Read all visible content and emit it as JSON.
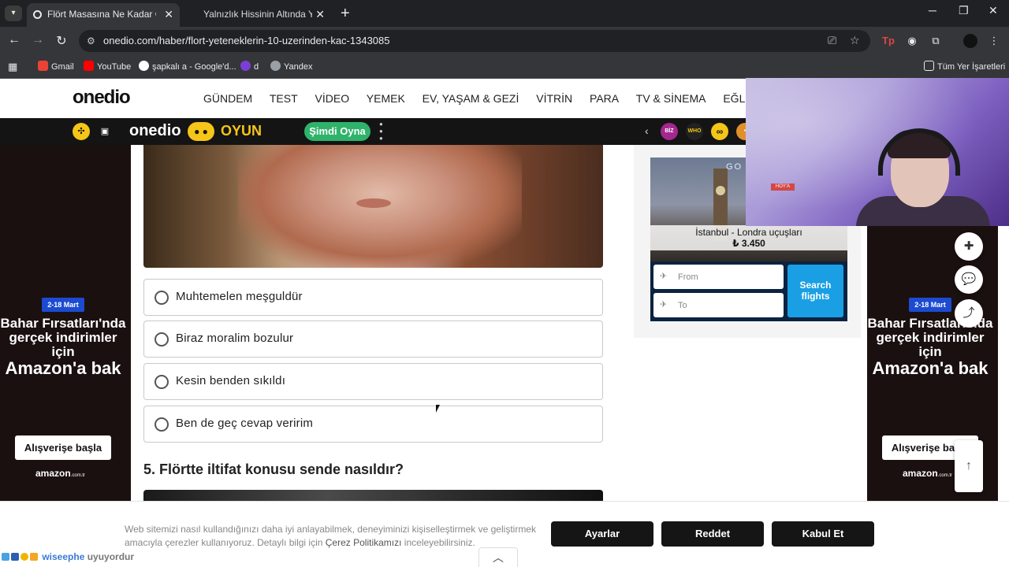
{
  "browser": {
    "tabs": [
      {
        "title": "Flört Masasına Ne Kadar Güçlü",
        "active": true
      },
      {
        "title": "Yalnızlık Hissinin Altında Yatan (",
        "active": false
      }
    ],
    "new_tab": "+",
    "url": "onedio.com/haber/flort-yeteneklerin-10-uzerinden-kac-1343085",
    "bookmarks": [
      "Gmail",
      "YouTube",
      "şapkalı a - Google'd...",
      "d",
      "Yandex"
    ],
    "all_bookmarks": "Tüm Yer İşaretleri",
    "icons": {
      "back": "←",
      "forward": "→",
      "reload": "↻",
      "star": "☆",
      "menu": "⋮",
      "minimize": "─",
      "maximize": "❐",
      "close": "✕"
    }
  },
  "site": {
    "logo": "onedio",
    "nav": [
      "GÜNDEM",
      "TEST",
      "VİDEO",
      "YEMEK",
      "EV, YAŞAM & GEZİ",
      "VİTRİN",
      "PARA",
      "TV & SİNEMA",
      "EĞLENCE"
    ]
  },
  "gamebar": {
    "logo": "onedio",
    "oyun": "OYUN",
    "play": "Şimdi Oyna",
    "games": [
      "BİZ POS",
      "WHO WAS",
      "∞",
      "•"
    ]
  },
  "quiz": {
    "options": [
      "Muhtemelen meşguldür",
      "Biraz moralim bozulur",
      "Kesin benden sıkıldı",
      "Ben de geç cevap veririm"
    ],
    "question": "5. Flörtte iltifat konusu sende nasıldır?"
  },
  "ad": {
    "badge": "2-18 Mart",
    "line1": "Bahar Fırsatları'nda",
    "line2": "gerçek indirimler için",
    "line3": "Amazon'a bak",
    "cta": "Alışverişe başla",
    "brand": "amazon",
    "brand_suffix": ".com.tr"
  },
  "flight": {
    "brand": "GO TO",
    "route": "İstanbul - Londra uçuşları",
    "price": "₺ 3.450",
    "from_placeholder": "From",
    "to_placeholder": "To",
    "search": "Search flights"
  },
  "webcam": {
    "sign": "HOY'A"
  },
  "cookie": {
    "text_part1": "Web sitemizi nasıl kullandığınızı daha iyi anlayabilmek, deneyiminizi kişiselleştirmek ve geliştirmek amacıyla çerezler kullanıyoruz. Detaylı bilgi için ",
    "link": "Çerez Politikamızı",
    "text_part2": " inceleyebilirsiniz.",
    "settings": "Ayarlar",
    "reject": "Reddet",
    "accept": "Kabul Et"
  },
  "stream_overlay": {
    "user": "wiseephe",
    "status": "uyuyordur"
  }
}
